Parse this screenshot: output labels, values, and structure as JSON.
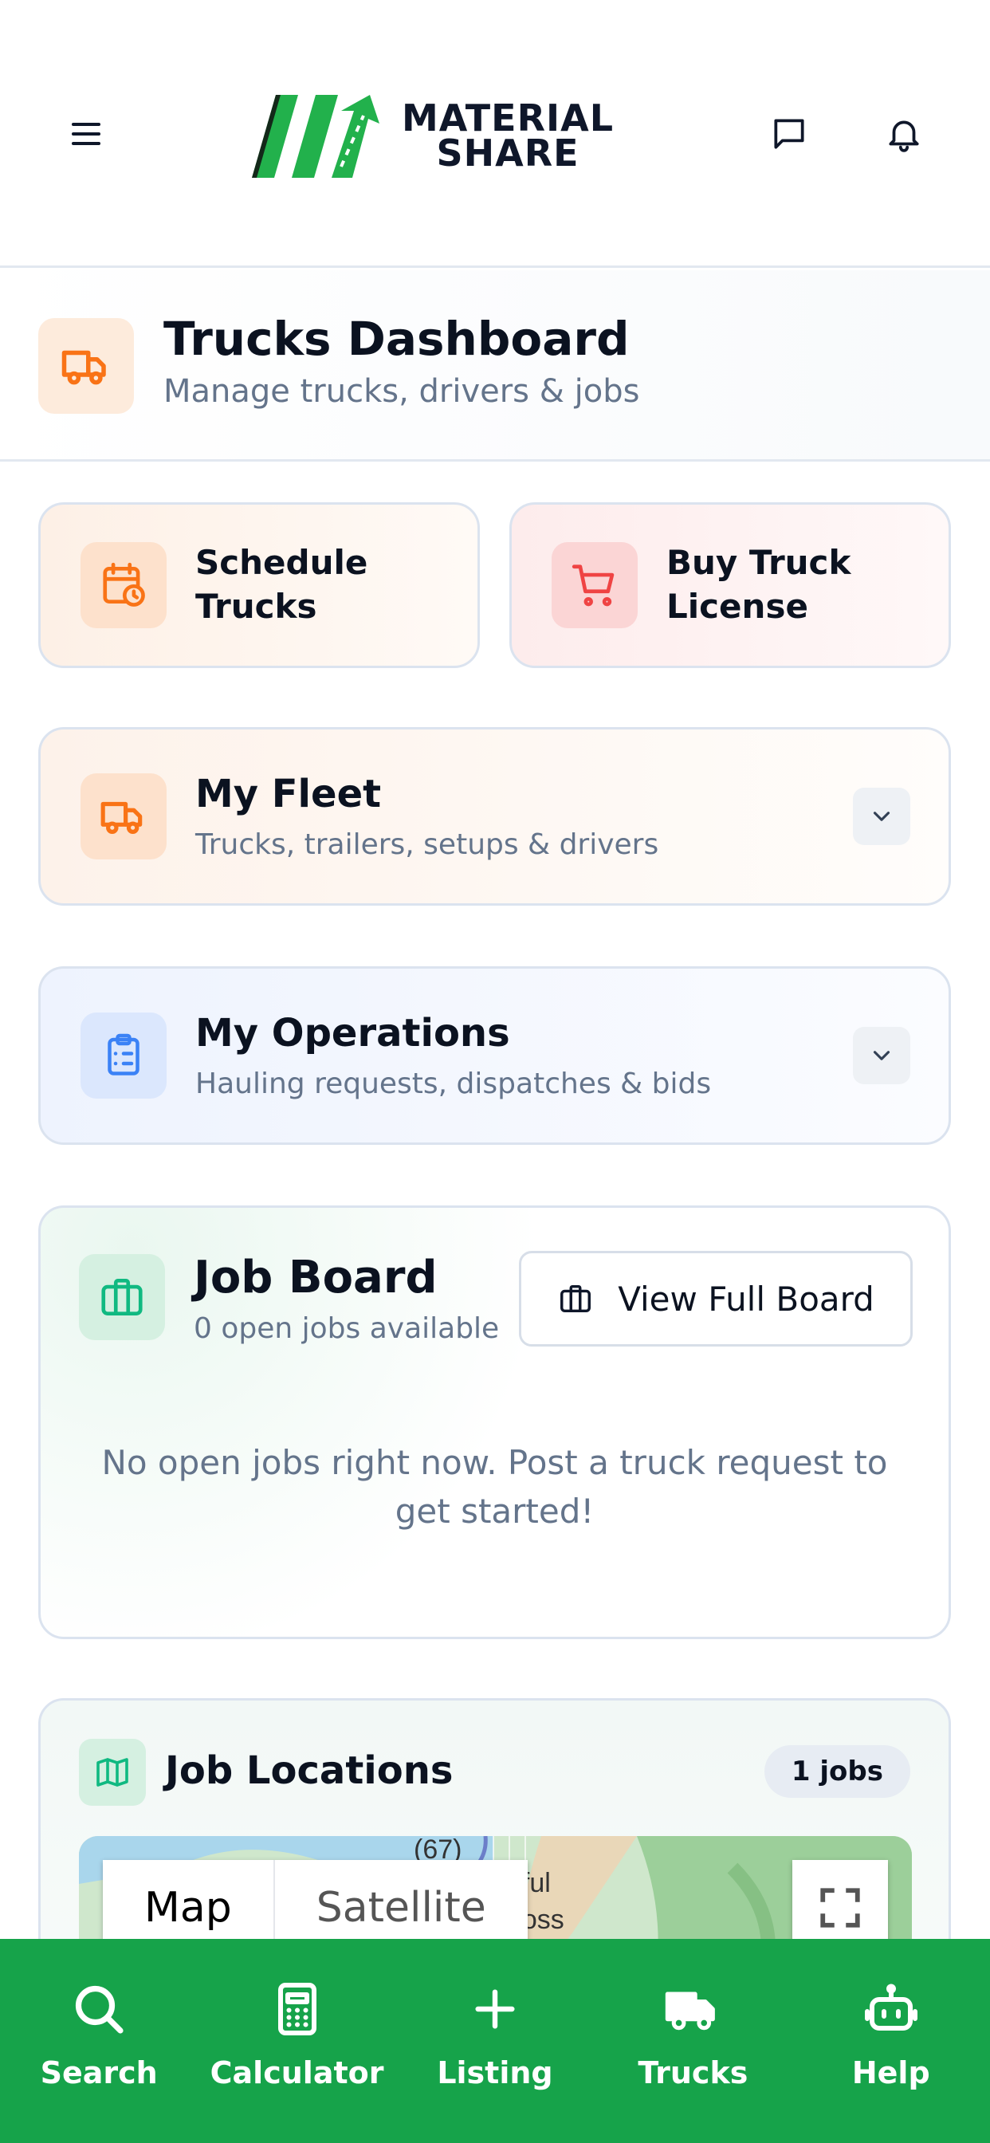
{
  "header": {
    "logo_line1": "MATERIAL",
    "logo_line2": "SHARE"
  },
  "title_band": {
    "title": "Trucks Dashboard",
    "subtitle": "Manage trucks, drivers & jobs"
  },
  "quick_actions": [
    {
      "label": "Schedule Trucks",
      "icon": "calendar-clock-icon",
      "color": "#f97316"
    },
    {
      "label": "Buy Truck License",
      "icon": "cart-icon",
      "color": "#ef4444"
    }
  ],
  "fleet": {
    "title": "My Fleet",
    "subtitle": "Trucks, trailers, setups & drivers"
  },
  "operations": {
    "title": "My Operations",
    "subtitle": "Hauling requests, dispatches & bids"
  },
  "job_board": {
    "title": "Job Board",
    "subtitle": "0 open jobs available",
    "view_button": "View Full Board",
    "empty_message": "No open jobs right now. Post a truck request to get started!"
  },
  "job_locations": {
    "title": "Job Locations",
    "badge": "1 jobs",
    "map_tab_map": "Map",
    "map_tab_satellite": "Satellite",
    "map_road_label": "(67)",
    "map_place_label_1": "ntiful",
    "map_place_label_2": "Cross"
  },
  "bottom_nav": [
    {
      "label": "Search",
      "icon": "search-icon"
    },
    {
      "label": "Calculator",
      "icon": "calculator-icon"
    },
    {
      "label": "Listing",
      "icon": "plus-icon"
    },
    {
      "label": "Trucks",
      "icon": "truck-icon"
    },
    {
      "label": "Help",
      "icon": "robot-icon"
    }
  ],
  "colors": {
    "brand_green": "#16a34a",
    "orange": "#f97316",
    "red": "#ef4444",
    "blue": "#3b82f6",
    "emerald": "#10b981"
  }
}
